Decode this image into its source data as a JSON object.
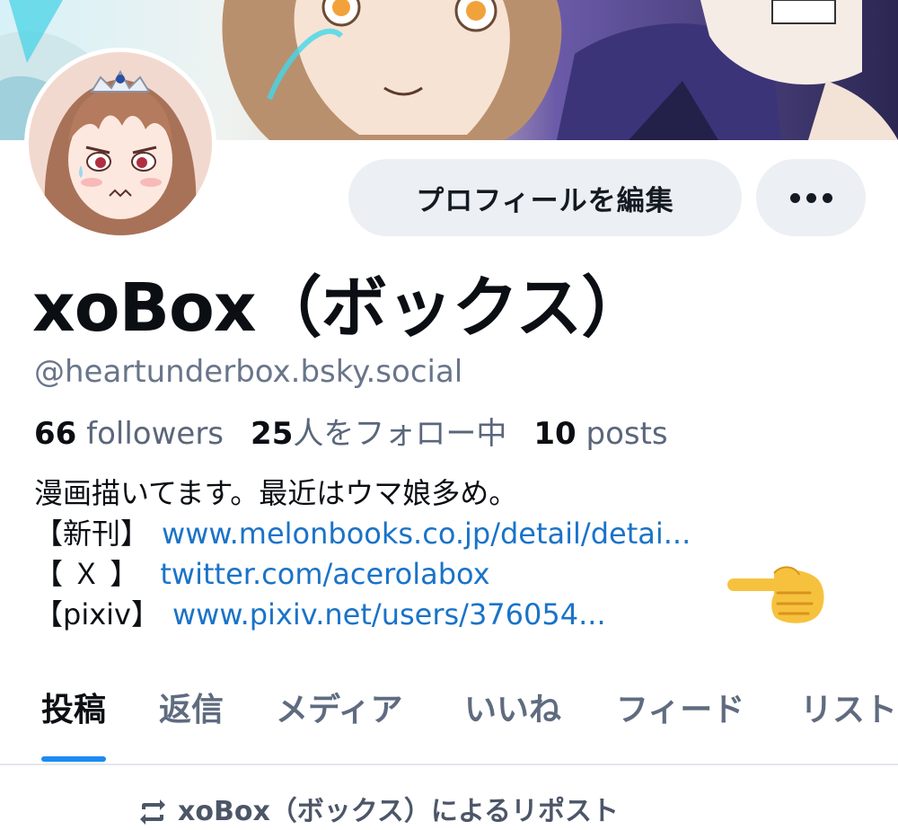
{
  "profile": {
    "display_name": "xoBox（ボックス）",
    "handle": "@heartunderbox.bsky.social",
    "edit_button_label": "プロフィールを編集",
    "more_icon": "ellipsis-icon"
  },
  "stats": {
    "followers_count": "66",
    "followers_label": "followers",
    "following_count": "25",
    "following_label": "人をフォロー中",
    "posts_count": "10",
    "posts_label": "posts"
  },
  "bio": {
    "line1": "漫画描いてます。最近はウマ娘多め。",
    "line2_tag": "【新刊】",
    "line2_link": "www.melonbooks.co.jp/detail/detai...",
    "line3_tag": "【 Ｘ 】",
    "line3_link": "twitter.com/acerolabox",
    "line4_tag": "【pixiv】",
    "line4_link": "www.pixiv.net/users/376054..."
  },
  "tabs": {
    "items": [
      "投稿",
      "返信",
      "メディア",
      "いいね",
      "フィード",
      "リスト"
    ],
    "active_index": 0
  },
  "feed": {
    "repost_text": "xoBox（ボックス）によるリポスト"
  },
  "colors": {
    "accent": "#1d8bf1",
    "link": "#1a73c8",
    "button_bg": "#eceff3",
    "muted_text": "#69758a"
  }
}
